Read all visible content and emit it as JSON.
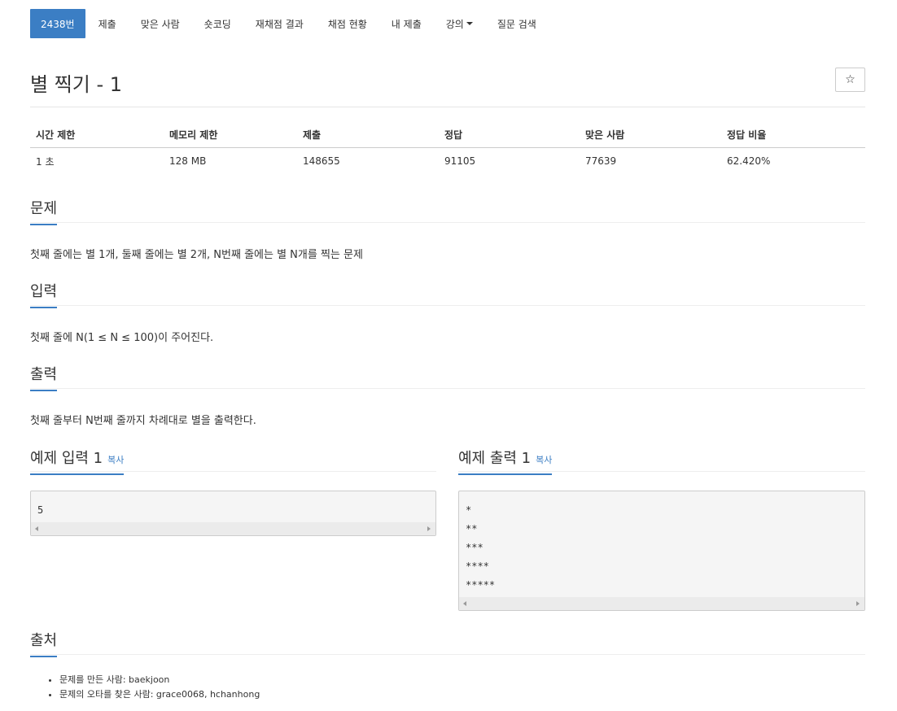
{
  "nav": {
    "problem_number": "2438번",
    "items": [
      "제출",
      "맞은 사람",
      "숏코딩",
      "재채점 결과",
      "채점 현황",
      "내 제출"
    ],
    "lecture": "강의",
    "question_search": "질문 검색"
  },
  "problem": {
    "title": "별 찍기 - 1",
    "star_icon": "☆"
  },
  "info": {
    "headers": [
      "시간 제한",
      "메모리 제한",
      "제출",
      "정답",
      "맞은 사람",
      "정답 비율"
    ],
    "values": [
      "1 초",
      "128 MB",
      "148655",
      "91105",
      "77639",
      "62.420%"
    ]
  },
  "sections": {
    "problem_title": "문제",
    "problem_text": "첫째 줄에는 별 1개, 둘째 줄에는 별 2개, N번째 줄에는 별 N개를 찍는 문제",
    "input_title": "입력",
    "input_text": "첫째 줄에 N(1 ≤ N ≤ 100)이 주어진다.",
    "output_title": "출력",
    "output_text": "첫째 줄부터 N번째 줄까지 차례대로 별을 출력한다.",
    "source_title": "출처"
  },
  "samples": {
    "input_title": "예제 입력 1",
    "output_title": "예제 출력 1",
    "copy_label": "복사",
    "input": "5",
    "output": "*\n**\n***\n****\n*****"
  },
  "source": [
    "문제를 만든 사람: baekjoon",
    "문제의 오타를 찾은 사람: grace0068, hchanhong"
  ]
}
